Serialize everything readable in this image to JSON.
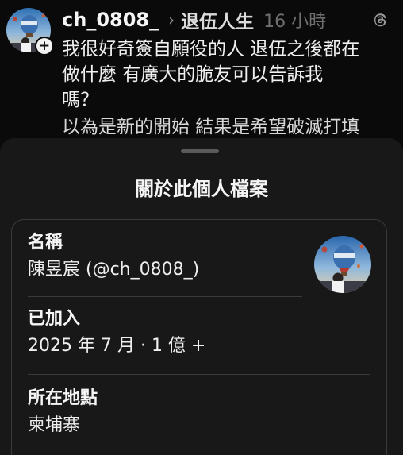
{
  "post": {
    "username": "ch_0808_",
    "separator": "›",
    "topic": "退伍人生",
    "time": "16 小時",
    "body_lines": [
      "我很好奇簽自願役的人 退伍之後都在",
      "做什麼 有廣大的脆友可以告訴我",
      "嗎？"
    ],
    "cut_line": "以為是新的開始 結果是希望破滅打填",
    "add_symbol": "+"
  },
  "sheet": {
    "title": "關於此個人檔案",
    "name_label": "名稱",
    "name_value": "陳昱宸 (@ch_0808_)",
    "joined_label": "已加入",
    "joined_value": "2025 年 7 月 · 1 億 +",
    "location_label": "所在地點",
    "location_value": "柬埔寨"
  },
  "colors": {
    "background": "#0a0a0a",
    "sheet": "#181818",
    "border": "#3a3a3a",
    "text": "#f5f5f5",
    "muted": "#6e6e6e"
  },
  "icons": {
    "threads": "threads-icon",
    "avatar": "avatar-hot-air-balloon",
    "add": "plus-icon"
  }
}
